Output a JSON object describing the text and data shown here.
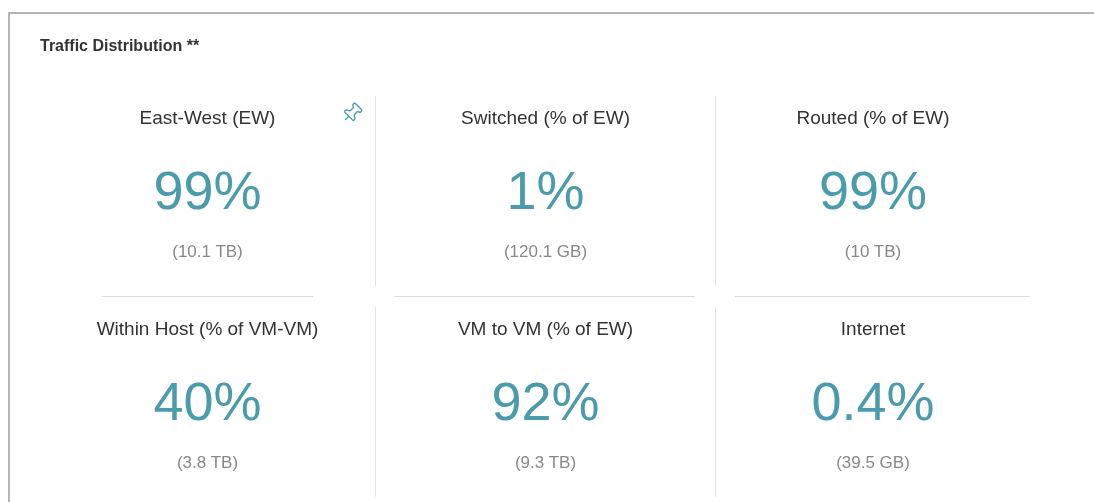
{
  "panel": {
    "title": "Traffic Distribution **",
    "tiles": [
      {
        "label": "East-West (EW)",
        "value": "99%",
        "detail": "(10.1 TB)"
      },
      {
        "label": "Switched (% of EW)",
        "value": "1%",
        "detail": "(120.1 GB)"
      },
      {
        "label": "Routed (% of EW)",
        "value": "99%",
        "detail": "(10 TB)"
      },
      {
        "label": "Within Host (% of VM-VM)",
        "value": "40%",
        "detail": "(3.8 TB)"
      },
      {
        "label": "VM to VM (% of EW)",
        "value": "92%",
        "detail": "(9.3 TB)"
      },
      {
        "label": "Internet",
        "value": "0.4%",
        "detail": "(39.5 GB)"
      }
    ]
  }
}
